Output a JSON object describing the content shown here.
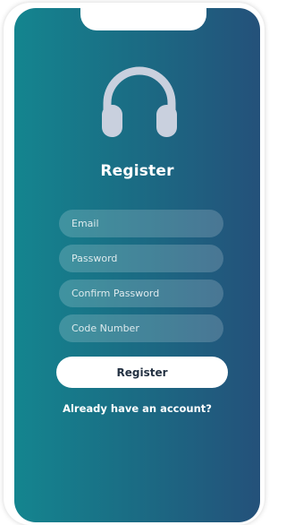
{
  "screen": {
    "title": "Register"
  },
  "form": {
    "email_placeholder": "Email",
    "password_placeholder": "Password",
    "confirm_password_placeholder": "Confirm Password",
    "code_number_placeholder": "Code Number",
    "register_label": "Register",
    "account_link_label": "Already have an account?"
  },
  "icons": {
    "logo": "headphones-icon"
  },
  "colors": {
    "gradient_start": "#14858f",
    "gradient_end": "#24517a",
    "button_background": "#ffffff",
    "button_text": "#233142"
  }
}
